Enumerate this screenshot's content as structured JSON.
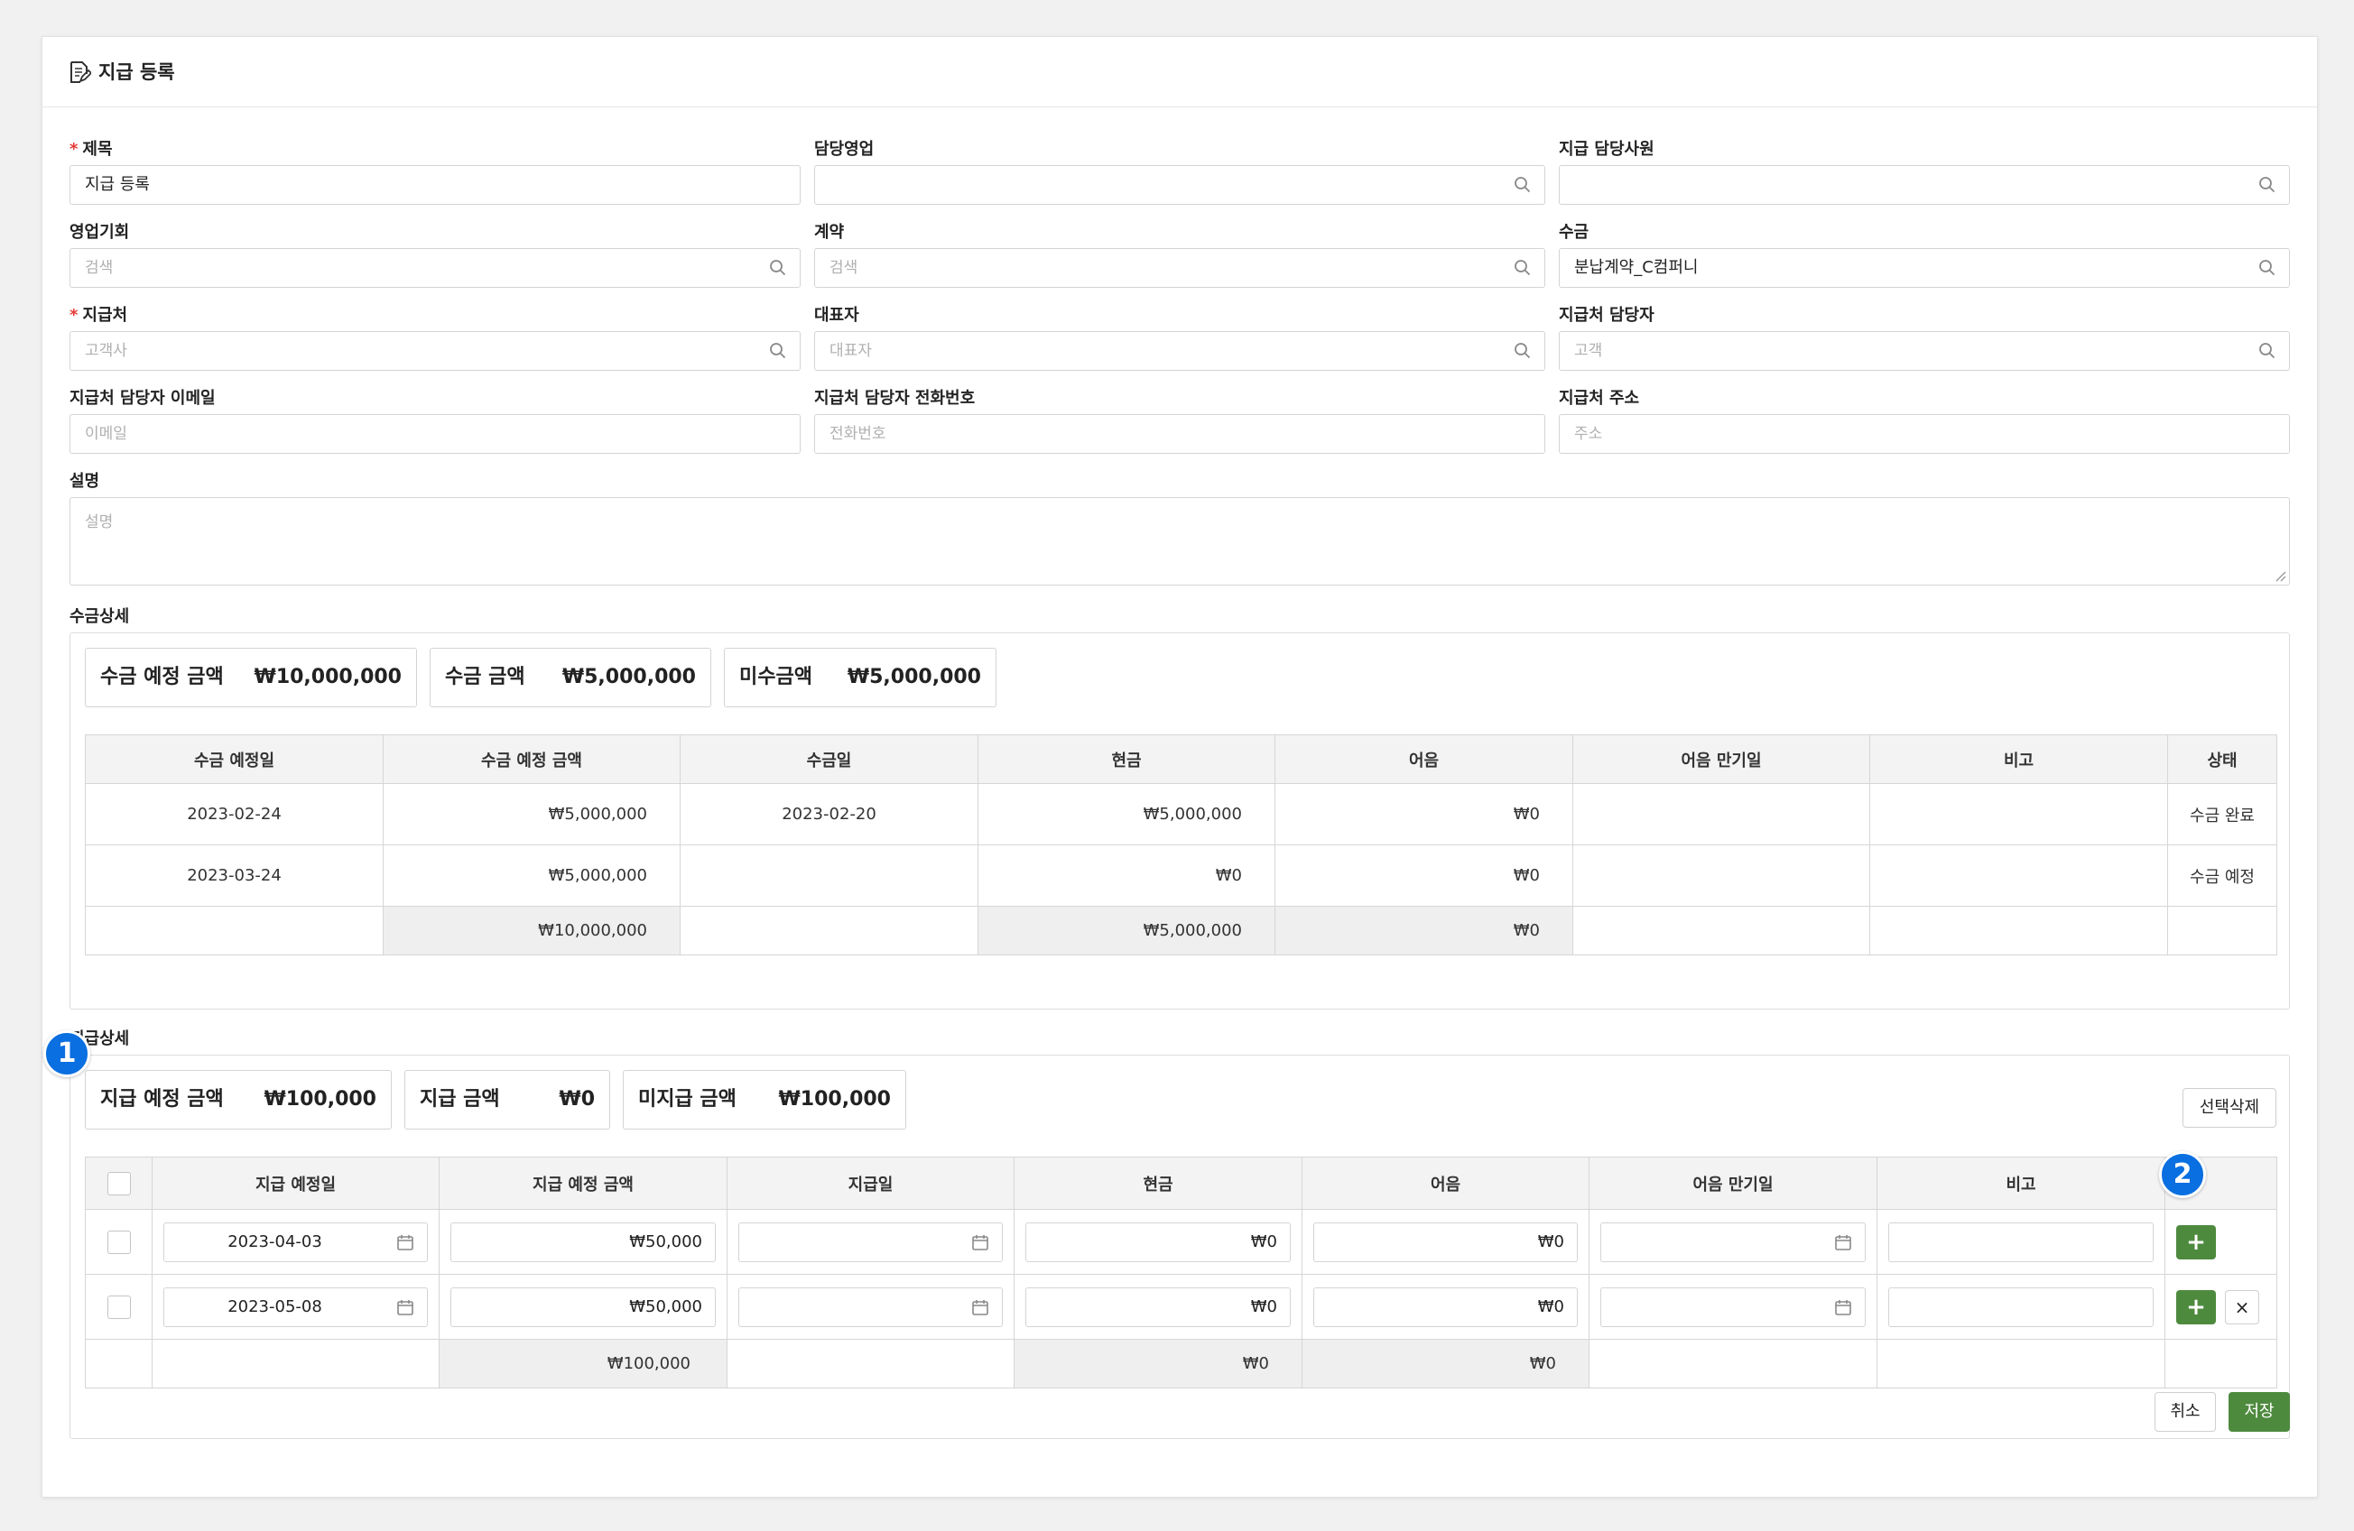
{
  "page": {
    "title": "지급 등록"
  },
  "form": {
    "title_label": "제목",
    "title_value": "지급 등록",
    "sales_rep_label": "담당영업",
    "pay_staff_label": "지급 담당사원",
    "opportunity_label": "영업기회",
    "opportunity_placeholder": "검색",
    "contract_label": "계약",
    "contract_placeholder": "검색",
    "receipt_label": "수금",
    "receipt_value": "분납계약_C컴퍼니",
    "payee_label": "지급처",
    "payee_placeholder": "고객사",
    "ceo_label": "대표자",
    "ceo_placeholder": "대표자",
    "payee_contact_label": "지급처 담당자",
    "payee_contact_placeholder": "고객",
    "email_label": "지급처 담당자 이메일",
    "email_placeholder": "이메일",
    "phone_label": "지급처 담당자 전화번호",
    "phone_placeholder": "전화번호",
    "address_label": "지급처 주소",
    "address_placeholder": "주소",
    "desc_label": "설명",
    "desc_placeholder": "설명",
    "required_mark": "*"
  },
  "receipt_detail": {
    "section_label": "수금상세",
    "summary": [
      {
        "label": "수금 예정 금액",
        "value": "₩10,000,000"
      },
      {
        "label": "수금 금액",
        "value": "₩5,000,000"
      },
      {
        "label": "미수금액",
        "value": "₩5,000,000"
      }
    ],
    "columns": [
      "수금 예정일",
      "수금 예정 금액",
      "수금일",
      "현금",
      "어음",
      "어음 만기일",
      "비고",
      "상태"
    ],
    "rows": [
      [
        "2023-02-24",
        "₩5,000,000",
        "2023-02-20",
        "₩5,000,000",
        "₩0",
        "",
        "",
        "수금 완료"
      ],
      [
        "2023-03-24",
        "₩5,000,000",
        "",
        "₩0",
        "₩0",
        "",
        "",
        "수금 예정"
      ]
    ],
    "total": [
      "",
      "₩10,000,000",
      "",
      "₩5,000,000",
      "₩0",
      "",
      "",
      ""
    ]
  },
  "payment_detail": {
    "section_label": "지급상세",
    "summary": [
      {
        "label": "지급 예정 금액",
        "value": "₩100,000"
      },
      {
        "label": "지급 금액",
        "value": "₩0"
      },
      {
        "label": "미지급 금액",
        "value": "₩100,000"
      }
    ],
    "delete_selected_label": "선택삭제",
    "columns": [
      "지급 예정일",
      "지급 예정 금액",
      "지급일",
      "현금",
      "어음",
      "어음 만기일",
      "비고"
    ],
    "rows": [
      {
        "due_date": "2023-04-03",
        "amount": "₩50,000",
        "pay_date": "",
        "cash": "₩0",
        "bill": "₩0",
        "bill_due": "",
        "note": ""
      },
      {
        "due_date": "2023-05-08",
        "amount": "₩50,000",
        "pay_date": "",
        "cash": "₩0",
        "bill": "₩0",
        "bill_due": "",
        "note": ""
      }
    ],
    "total": {
      "amount": "₩100,000",
      "cash": "₩0",
      "bill": "₩0"
    },
    "add_label": "+",
    "remove_label": "×"
  },
  "footer": {
    "cancel_label": "취소",
    "save_label": "저장"
  },
  "badges": [
    "1",
    "2"
  ],
  "colors": {
    "accent_green": "#4e8a3e",
    "badge_blue": "#0a6fe0",
    "required_red": "#e53935"
  },
  "icons": {
    "title": "document-edit-icon",
    "search": "search-icon",
    "calendar": "calendar-icon",
    "resize": "resize-grip-icon"
  }
}
